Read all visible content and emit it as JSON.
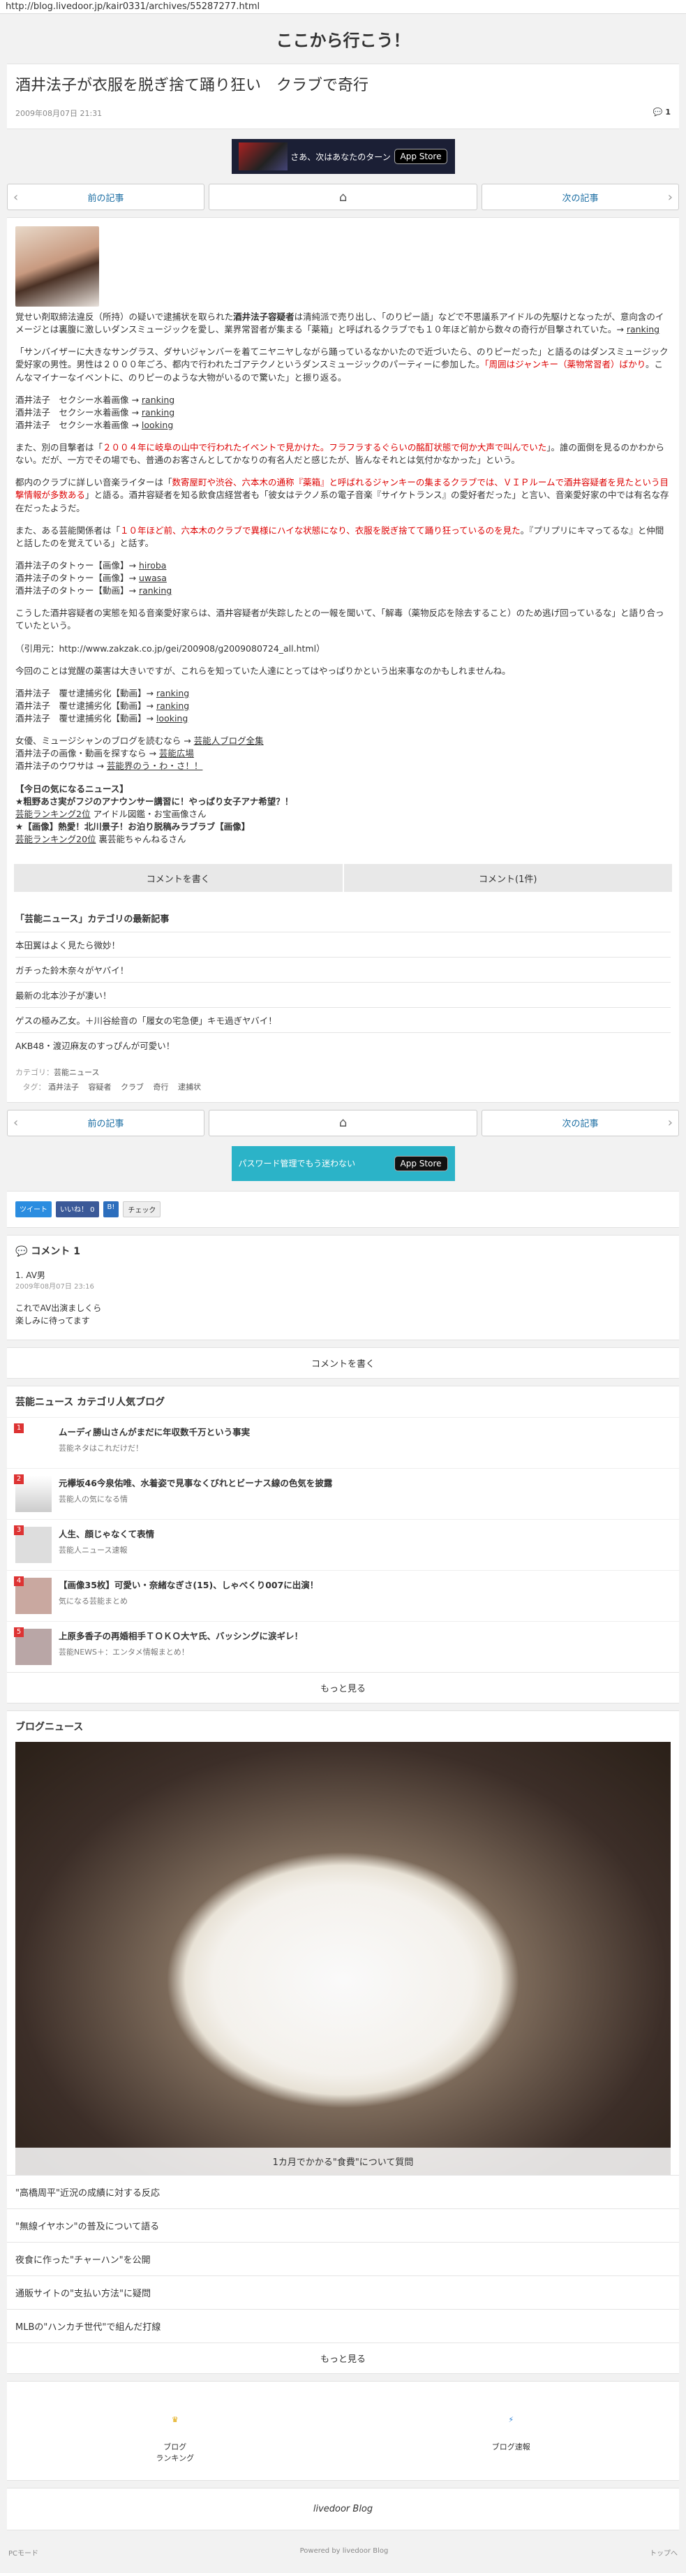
{
  "urlbar": "http://blog.livedoor.jp/kair0331/archives/55287277.html",
  "site_title": "ここから行こう！",
  "article": {
    "title": "酒井法子が衣服を脱ぎ捨て踊り狂い　クラブで奇行",
    "date": "2009年08月07日 21:31",
    "comment_count": "1"
  },
  "banner1": {
    "text": "さあ、次はあなたのターン",
    "store": "App Store"
  },
  "banner2": {
    "text": "パスワード管理でもう迷わない",
    "store": "App Store"
  },
  "pager": {
    "prev": "前の記事",
    "home": "⌂",
    "next": "次の記事"
  },
  "body": {
    "p1a": "覚せい剤取締法違反（所持）の疑いで逮捕状を取られた",
    "p1b": "酒井法子容疑者",
    "p1c": "は清純派で売り出し、「のりピー語」などで不思議系アイドルの先駆けとなったが、意向含のイメージとは裏腹に激しいダンスミュージックを愛し、業界常習者が集まる「薬箱」と呼ばれるクラブでも１０年ほど前から数々の奇行が目撃されていた。→ ",
    "p1_link": "ranking",
    "p2": "「サンバイザーに大きなサングラス、ダサいジャンバーを着てニヤニヤしながら踊っているなかいたので近づいたら、のりピーだった」と語るのはダンスミュージック愛好家の男性。男性は２０００年ごろ、都内で行われたゴアテクノというダンスミュージックのパーティーに参加した。",
    "p2_red": "「周囲はジャンキー（薬物常習者）ばかり",
    "p2_end": "。こんなマイナーなイベントに、のりピーのような大物がいるので驚いた」と振り返る。",
    "list1": [
      {
        "label": "酒井法子　セクシー水着画像 → ",
        "link": "ranking"
      },
      {
        "label": "酒井法子　セクシー水着画像 → ",
        "link": "ranking"
      },
      {
        "label": "酒井法子　セクシー水着画像 → ",
        "link": "looking"
      }
    ],
    "p3a": "また、別の目撃者は「",
    "p3_red": "２００４年に岐阜の山中で行われたイベントで見かけた。フラフラするぐらいの酩酊状態で何か大声で叫んでいた",
    "p3b": "」。誰の面倒を見るのかわからない。だが、一方でその場でも、普通のお客さんとしてかなりの有名人だと感じたが、皆んなそれとは気付かなかった」という。",
    "p4a": "都内のクラブに詳しい音楽ライターは「",
    "p4_red": "数寄屋町や渋谷、六本木の通称『薬箱』と呼ばれるジャンキーの集まるクラブでは、ＶＩＰルームで酒井容疑者を見たという目撃情報が多数ある",
    "p4b": "」と語る。酒井容疑者を知る飲食店経営者も「彼女はテクノ系の電子音楽『サイケトランス』の愛好者だった」と言い、音楽愛好家の中では有名な存在だったようだ。",
    "p5a": "また、ある芸能関係者は「",
    "p5_red": "１０年ほど前、六本木のクラブで異様にハイな状態になり、衣服を脱ぎ捨てて踊り狂っているのを見た",
    "p5b": "。『プリプリにキマってるな』と仲間と話したのを覚えている」と話す。",
    "list2": [
      {
        "label": "酒井法子のタトゥー【画像】→ ",
        "link": "hiroba"
      },
      {
        "label": "酒井法子のタトゥー【画像】→ ",
        "link": "uwasa"
      },
      {
        "label": "酒井法子のタトゥー【動画】→ ",
        "link": "ranking"
      }
    ],
    "p6": "こうした酒井容疑者の実態を知る音楽愛好家らは、酒井容疑者が失踪したとの一報を聞いて、「解毒（薬物反応を除去すること）のため逃げ回っているな」と語り合っていたという。",
    "p7": "（引用元：http://www.zakzak.co.jp/gei/200908/g2009080724_all.html）",
    "p8": "今回のことは覚醒の薬害は大きいですが、これらを知っていた人達にとってはやっぱりかという出来事なのかもしれませんね。",
    "list3": [
      {
        "label": "酒井法子　覆せ逮捕劣化【動画】→ ",
        "link": "ranking"
      },
      {
        "label": "酒井法子　覆せ逮捕劣化【動画】→ ",
        "link": "ranking"
      },
      {
        "label": "酒井法子　覆せ逮捕劣化【動画】→ ",
        "link": "looking"
      }
    ],
    "list4": [
      {
        "label": "女優、ミュージシャンのブログを読むなら → ",
        "link": "芸能人ブログ全集"
      },
      {
        "label": "酒井法子の画像・動画を探すなら → ",
        "link": "芸能広場"
      },
      {
        "label": "酒井法子のウワサは → ",
        "link": "芸能界のう・わ・さ！！"
      }
    ],
    "today_title": "【今日の気になるニュース】",
    "today1": "★粗野あさ実がフジのアナウンサー講習に！やっぱり女子アナ希望？！",
    "today1_link": "芸能ランキング2位",
    "today1_sub": " アイドル図鑑・お宝画像さん",
    "today2": "★【画像】熱愛！北川景子！お泊り脱稿みラブラブ【画像】",
    "today2_link": "芸能ランキング20位",
    "today2_sub": " 裏芸能ちゃんねるさん"
  },
  "buttons": {
    "write": "コメントを書く",
    "comments": "コメント(1件)"
  },
  "latest": {
    "heading": "「芸能ニュース」カテゴリの最新記事",
    "items": [
      "本田翼はよく見たら微妙！",
      "ガチった鈴木奈々がヤバイ！",
      "最新の北本沙子が凄い！",
      "ゲスの極み乙女。＋川谷絵音の「履女の宅急便」キモ過ぎヤバイ！",
      "AKB48・渡辺麻友のすっぴんが可愛い！"
    ],
    "category_label": "カテゴリ：",
    "category": "芸能ニュース",
    "tag_label": "タグ：",
    "tags": [
      "酒井法子",
      "容疑者",
      "クラブ",
      "奇行",
      "逮捕状"
    ]
  },
  "social": {
    "tweet": "ツイート",
    "like": "いいね！ 0",
    "hatena": "B!",
    "check": "チェック"
  },
  "comments": {
    "title": "コメント",
    "count": "1",
    "items": [
      {
        "author": "1. AV男",
        "date": "2009年08月07日 23:16",
        "text1": "これでAV出演ましくら",
        "text2": "楽しみに待ってます"
      }
    ],
    "write": "コメントを書く"
  },
  "ranking": {
    "title": "芸能ニュース カテゴリ人気ブログ",
    "items": [
      {
        "num": "1",
        "title": "ムーディ勝山さんがまだに年収数千万という事実",
        "sub": "芸能ネタはこれだけだ！"
      },
      {
        "num": "2",
        "title": "元欅坂46今泉佑唯、水着姿で見事なくびれとビーナス線の色気を披露",
        "sub": "芸能人の気になる情"
      },
      {
        "num": "3",
        "title": "人生、顔じゃなくて表情",
        "sub": "芸能人ニュース速報"
      },
      {
        "num": "4",
        "title": "【画像35枚】可愛い・奈緒なぎさ(15)、しゃべくり007に出演！",
        "sub": "気になる芸能まとめ"
      },
      {
        "num": "5",
        "title": "上原多香子の再婚相手ＴＯＫＯ大ヤ氏、バッシングに涙ギレ！",
        "sub": "芸能NEWS＋：エンタメ情報まとめ！"
      }
    ],
    "more": "もっと見る"
  },
  "blognews": {
    "title": "ブログニュース",
    "hero_caption": "1カ月でかかる\"食費\"について質問",
    "items": [
      "\"高橋周平\"近況の成績に対する反応",
      "\"無線イヤホン\"の普及について語る",
      "夜食に作った\"チャーハン\"を公開",
      "通販サイトの\"支払い方法\"に疑問",
      "MLBの\"ハンカチ世代\"で組んだ打線"
    ],
    "more": "もっと見る"
  },
  "footer": {
    "ranking": "ブログ\nランキング",
    "speed": "ブログ速報",
    "logo": "livedoor Blog",
    "pc": "PCモード",
    "powered": "Powered by livedoor Blog",
    "top": "トップへ"
  }
}
